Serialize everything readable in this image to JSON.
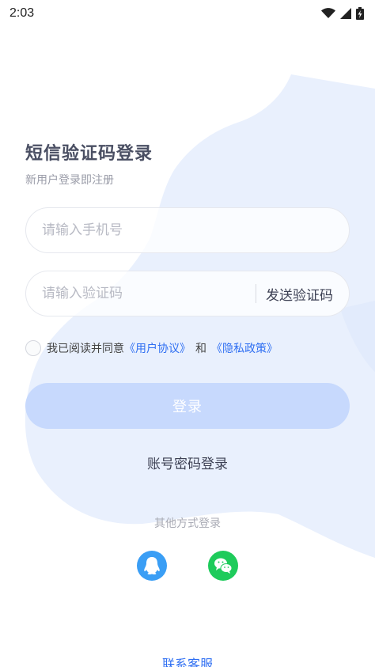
{
  "status_bar": {
    "time": "2:03"
  },
  "header": {
    "title": "短信验证码登录",
    "subtitle": "新用户登录即注册"
  },
  "form": {
    "phone_placeholder": "请输入手机号",
    "code_placeholder": "请输入验证码",
    "send_code_label": "发送验证码"
  },
  "agreement": {
    "prefix": "我已阅读并同意",
    "user_agreement": "《用户协议》",
    "and": "和",
    "privacy_policy": "《隐私政策》"
  },
  "actions": {
    "login_label": "登录",
    "password_login_label": "账号密码登录"
  },
  "other_login": {
    "title": "其他方式登录",
    "methods": [
      "qq-icon",
      "wechat-icon"
    ]
  },
  "footer": {
    "contact_label": "联系客服"
  },
  "colors": {
    "primary": "#2f6ff2",
    "login_button_disabled": "#c7d9fd",
    "qq": "#3a9ef5",
    "wechat": "#1ecb5b",
    "background_art": "#e9f0fd"
  }
}
